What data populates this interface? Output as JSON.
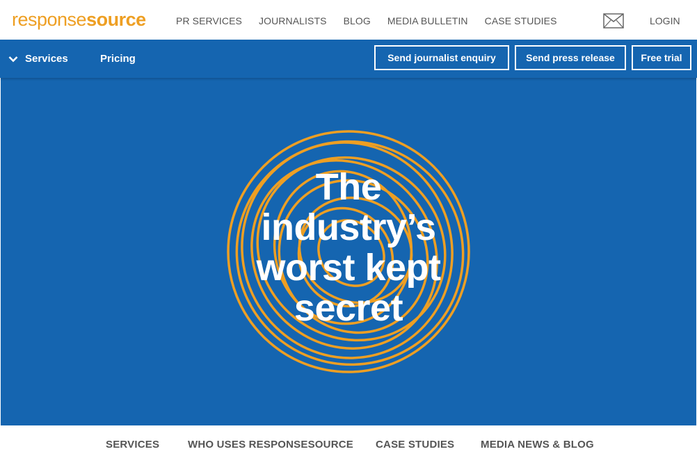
{
  "brand": {
    "logo_light": "response",
    "logo_bold": "source",
    "accent": "#ee9f23",
    "primary": "#1565b0"
  },
  "top_nav": {
    "items": [
      "PR SERVICES",
      "JOURNALISTS",
      "BLOG",
      "MEDIA BULLETIN",
      "CASE STUDIES"
    ],
    "mail_icon": "envelope-icon",
    "login": "LOGIN"
  },
  "sub_nav": {
    "services": "Services",
    "services_icon": "chevron-down-icon",
    "pricing": "Pricing",
    "cta": [
      "Send journalist enquiry",
      "Send press release",
      "Free trial"
    ]
  },
  "hero": {
    "lines": [
      "The",
      "industry’s",
      "worst kept",
      "secret"
    ],
    "graphic": "orange-swirl-ring"
  },
  "bottom_nav": {
    "items": [
      "SERVICES",
      "WHO USES RESPONSESOURCE",
      "CASE STUDIES",
      "MEDIA NEWS & BLOG"
    ]
  }
}
